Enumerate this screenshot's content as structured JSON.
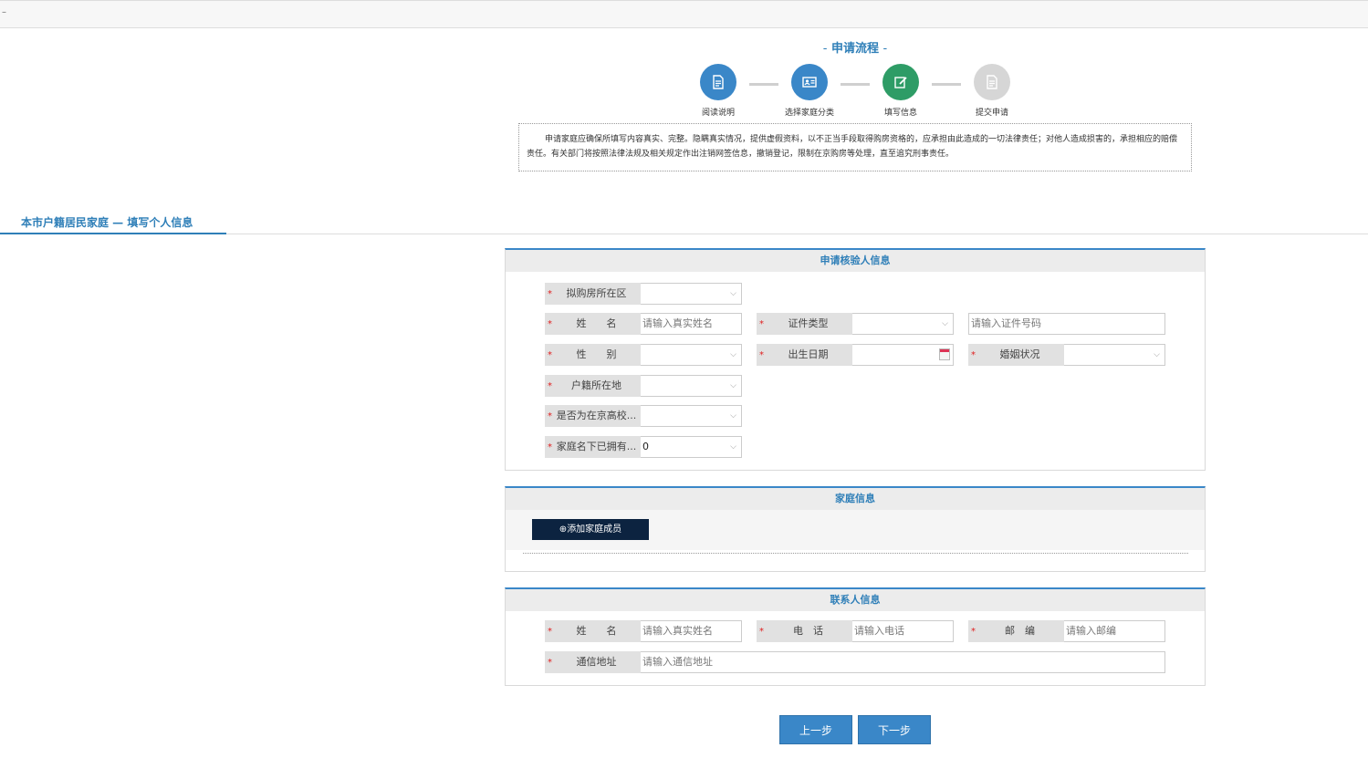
{
  "topbar": {
    "mark": "–"
  },
  "process": {
    "title": "申请流程",
    "dash": "-",
    "steps": [
      {
        "label": "阅读说明",
        "icon": "document-icon",
        "state": "done",
        "color": "#3a87c8"
      },
      {
        "label": "选择家庭分类",
        "icon": "id-card-icon",
        "state": "done",
        "color": "#3a87c8"
      },
      {
        "label": "填写信息",
        "icon": "edit-icon",
        "state": "current",
        "color": "#2e9c66"
      },
      {
        "label": "提交申请",
        "icon": "document-icon",
        "state": "pending",
        "color": "#d6d6d6"
      }
    ]
  },
  "notice": "申请家庭应确保所填写内容真实、完整。隐瞒真实情况，提供虚假资料，以不正当手段取得购房资格的，应承担由此造成的一切法律责任；对他人造成损害的，承担相应的赔偿责任。有关部门将按照法律法规及相关规定作出注销网签信息，撤销登记，限制在京购房等处理，直至追究刑事责任。",
  "section": {
    "title": "本市户籍居民家庭 — 填写个人信息"
  },
  "applicant": {
    "heading": "申请核验人信息",
    "district": {
      "label": "拟购房所在区",
      "value": ""
    },
    "name": {
      "label": "姓　　名",
      "placeholder": "请输入真实姓名"
    },
    "id_type": {
      "label": "证件类型",
      "value": ""
    },
    "id_number": {
      "placeholder": "请输入证件号码"
    },
    "gender": {
      "label": "性　　别",
      "value": ""
    },
    "birth_date": {
      "label": "出生日期",
      "value": ""
    },
    "marital": {
      "label": "婚姻状况",
      "value": ""
    },
    "hukou": {
      "label": "户籍所在地",
      "value": ""
    },
    "student": {
      "label": "是否为在京高校...",
      "value": ""
    },
    "owned": {
      "label": "家庭名下已拥有...",
      "value": "0"
    }
  },
  "family": {
    "heading": "家庭信息",
    "add_button": "添加家庭成员"
  },
  "contact": {
    "heading": "联系人信息",
    "name": {
      "label": "姓　　名",
      "placeholder": "请输入真实姓名"
    },
    "phone": {
      "label": "电　话",
      "placeholder": "请输入电话"
    },
    "postcode": {
      "label": "邮　编",
      "placeholder": "请输入邮编"
    },
    "address": {
      "label": "通信地址",
      "placeholder": "请输入通信地址"
    }
  },
  "nav": {
    "prev": "上一步",
    "next": "下一步"
  },
  "required_mark": "*",
  "colors": {
    "accent": "#3a87c8",
    "current_step": "#2e9c66",
    "required": "#e02020",
    "add_button_bg": "#0c2340"
  }
}
